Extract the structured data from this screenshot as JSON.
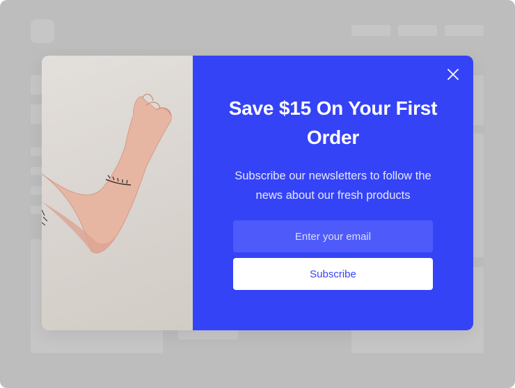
{
  "popup": {
    "title": "Save $15 On Your First Order",
    "subtitle": "Subscribe our newsletters to follow the news about our fresh products",
    "email_placeholder": "Enter your email",
    "subscribe_label": "Subscribe",
    "close_icon": "close-icon",
    "image_icon": "arm-tattoo-photo"
  },
  "colors": {
    "accent": "#3543f7",
    "input_bg": "#4e5bfa",
    "button_bg": "#ffffff",
    "overlay": "#bdbdbd"
  }
}
